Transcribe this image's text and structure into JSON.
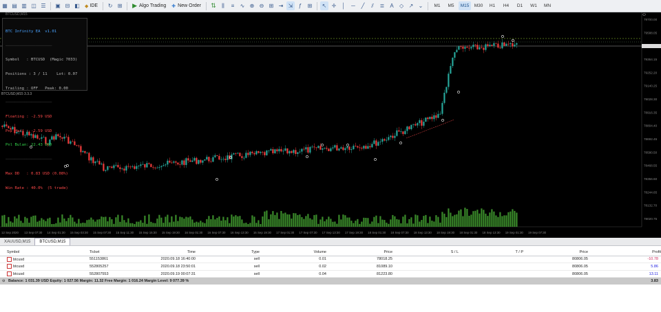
{
  "toolbar": {
    "ide_label": "IDE",
    "algo_label": "Algo Trading",
    "new_order_label": "New Order",
    "timeframes": [
      "M1",
      "M5",
      "M15",
      "M30",
      "H1",
      "H4",
      "D1",
      "W1",
      "MN"
    ],
    "active_timeframe": "M15"
  },
  "chart": {
    "title_text": "BTCUSD,M15",
    "indicator_label": "BTCUSD,M15 3.3.3",
    "price_labels": [
      "79700.00",
      "79588.05",
      "79476.10",
      "79364.15",
      "79252.20",
      "79140.25",
      "79028.30",
      "78916.35",
      "78804.40",
      "78692.45",
      "78580.50",
      "78468.55",
      "78356.60",
      "78244.65",
      "78132.70",
      "78020.75"
    ],
    "time_labels": [
      "12 Sep 2020",
      "13 Sep 07:30",
      "14 Sep 01:30",
      "15 Sep 03:30",
      "15 Sep 07:30",
      "15 Sep 11:30",
      "15 Sep 15:30",
      "15 Sep 19:30",
      "16 Sep 01:30",
      "16 Sep 07:30",
      "16 Sep 13:30",
      "16 Sep 19:30",
      "17 Sep 01:30",
      "17 Sep 07:30",
      "17 Sep 13:30",
      "17 Sep 19:30",
      "18 Sep 01:30",
      "18 Sep 07:30",
      "18 Sep 13:30",
      "18 Sep 19:30",
      "18 Sep 01:30",
      "18 Sep 13:30",
      "19 Sep 01:30",
      "19 Sep 07:30"
    ]
  },
  "panel": {
    "title": "BTC Infinity EA  v1.01",
    "symbol": "Symbol   : BTCUSD  (Magic 7033)",
    "positions": "Positions : 3 / 11    Lot: 0.07",
    "trailing": "Trailing : OFF   Peak: 0.00",
    "floating": "Floating : -2.59 USD",
    "pnl_hari": "Pnl Hari : -2.59 USD",
    "pnl_bulan": "Pnl Bulan: 22.43 USD",
    "max_dd": "Max DD   : 0.83 USD (0.08%)",
    "win_rate": "Win Rate : 40.0%  (5 trade)",
    "colors": {
      "title": "#4aa3ff",
      "normal": "#c8c8c8",
      "negative": "#ff4a4a",
      "positive": "#33d14a"
    }
  },
  "tabs": {
    "items": [
      "XAUUSD,M15",
      "BTCUSD,M15"
    ],
    "active": "BTCUSD,M15"
  },
  "table": {
    "headers": {
      "symbol": "Symbol",
      "ticket": "Ticket",
      "time": "Time",
      "type": "Type",
      "volume": "Volume",
      "price": "Price",
      "sl": "S / L",
      "tp": "T / P",
      "cur_price": "Price",
      "profit": "Profit"
    },
    "rows": [
      {
        "symbol": "btcusd",
        "ticket": "551153861",
        "time": "2020.09.18 16:40:00",
        "type": "sell",
        "volume": "0.01",
        "price": "78018.25",
        "cur_price": "80806.05",
        "profit": "-10.78"
      },
      {
        "symbol": "btcusd",
        "ticket": "552805257",
        "time": "2020.09.18 23:50:01",
        "type": "sell",
        "volume": "0.02",
        "price": "81089.10",
        "cur_price": "80806.05",
        "profit": "5.86"
      },
      {
        "symbol": "btcusd",
        "ticket": "552807553",
        "time": "2020.09.19 00:07:31",
        "type": "sell",
        "volume": "0.04",
        "price": "81223.80",
        "cur_price": "80806.05",
        "profit": "13.11"
      }
    ],
    "balance_line": "Balance: 1 031.39 USD  Equity: 1 027.56  Margin: 11.32  Free Margin: 1 016.24  Margin Level: 9 077.39 %",
    "balance_profit": "3.83"
  },
  "colors": {
    "bull": "#26a69a",
    "bear": "#ef3b3b",
    "volume": "#3a8a2a",
    "background": "#000000"
  }
}
